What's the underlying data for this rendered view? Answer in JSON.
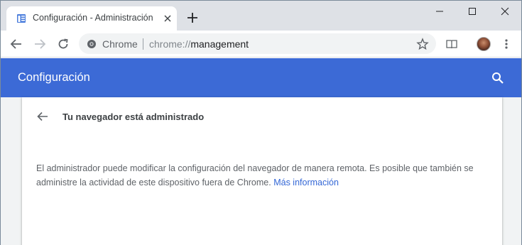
{
  "colors": {
    "accent": "#3c6ad6",
    "link": "#3367d6",
    "tabstrip": "#dee1e6"
  },
  "tab": {
    "title": "Configuración - Administración",
    "favicon": "settings-page-icon"
  },
  "omnibox": {
    "site_label": "Chrome",
    "url_scheme": "chrome://",
    "url_host": "management"
  },
  "settings_header": {
    "title": "Configuración"
  },
  "card": {
    "title": "Tu navegador está administrado",
    "body": "El administrador puede modificar la configuración del navegador de manera remota. Es posible que también se administre la actividad de este dispositivo fuera de Chrome.",
    "link": "Más información"
  }
}
